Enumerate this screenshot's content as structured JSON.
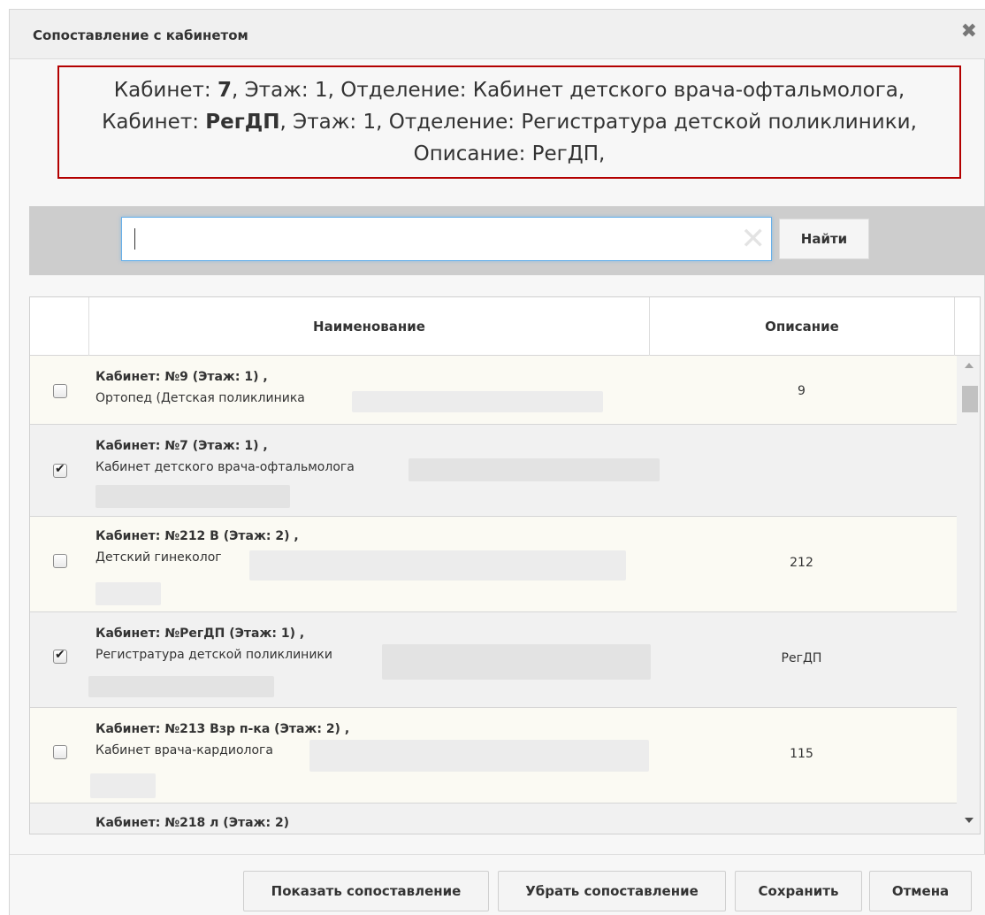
{
  "dialog": {
    "title": "Сопоставление с кабинетом",
    "close_icon": "close-icon"
  },
  "info": {
    "line1_label": "Кабинет: ",
    "line1_bold": "7",
    "line1_rest": ", Этаж: 1, Отделение: Кабинет детского врача-офтальмолога,",
    "line2_label": "Кабинет: ",
    "line2_bold": "РегДП",
    "line2_rest": ", Этаж: 1, Отделение: Регистратура детской поликлиники,",
    "line3": "Описание: РегДП,"
  },
  "search": {
    "value": "",
    "placeholder": "",
    "find_label": "Найти"
  },
  "table": {
    "headers": {
      "name": "Наименование",
      "description": "Описание"
    },
    "rows": [
      {
        "title": "Кабинет: №9 (Этаж: 1) ,",
        "department": "Ортопед (Детская поликлиника",
        "description": "9",
        "checked": false
      },
      {
        "title": "Кабинет: №7 (Этаж: 1) ,",
        "department": "Кабинет детского врача-офтальмолога",
        "description": "",
        "checked": true
      },
      {
        "title": "Кабинет: №212 В (Этаж: 2) ,",
        "department": "Детский гинеколог",
        "description": "212",
        "checked": false
      },
      {
        "title": "Кабинет: №РегДП (Этаж: 1) ,",
        "department": "Регистратура детской поликлиники",
        "description": "РегДП",
        "checked": true
      },
      {
        "title": "Кабинет: №213 Взр п-ка (Этаж: 2) ,",
        "department": "Кабинет врача-кардиолога",
        "description": "115",
        "checked": false
      },
      {
        "title": "Кабинет: №218 л (Этаж: 2)",
        "department": "",
        "description": "",
        "checked": false
      }
    ]
  },
  "footer": {
    "show_mapping": "Показать сопоставление",
    "remove_mapping": "Убрать сопоставление",
    "save": "Сохранить",
    "cancel": "Отмена"
  },
  "colors": {
    "highlight_border": "#b30000",
    "search_focus": "#66afe9"
  }
}
